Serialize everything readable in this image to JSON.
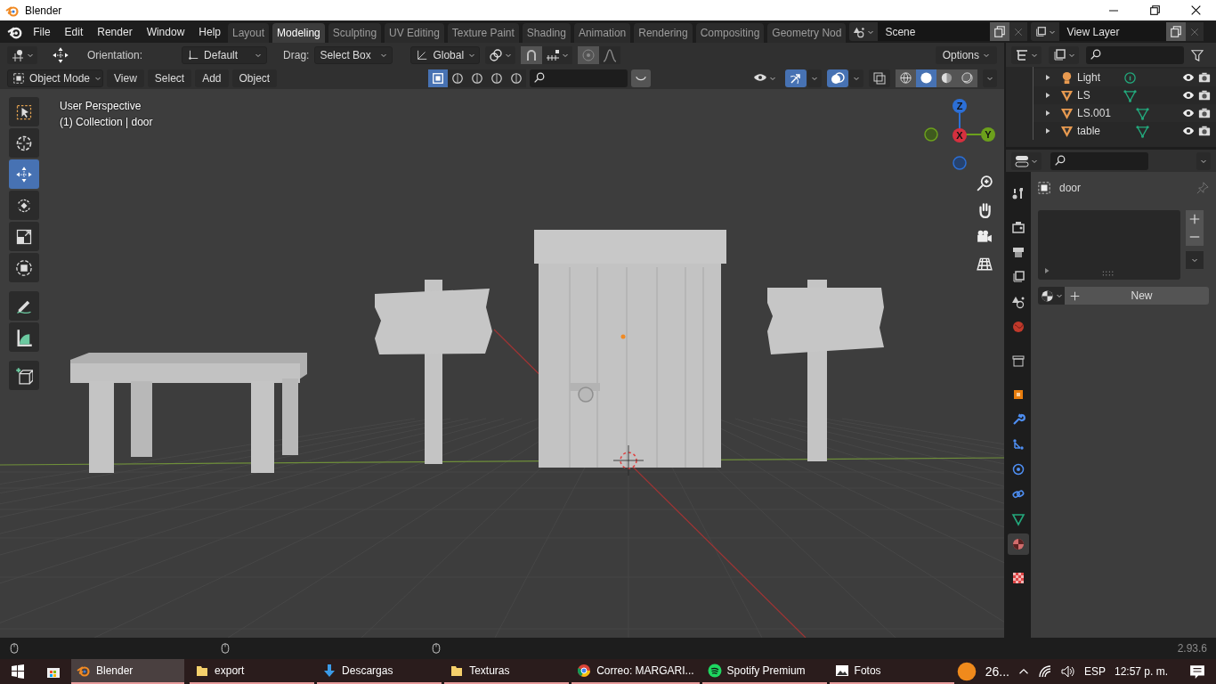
{
  "window": {
    "title": "Blender"
  },
  "menu": [
    "File",
    "Edit",
    "Render",
    "Window",
    "Help"
  ],
  "workspaces": [
    {
      "label": "Layout",
      "selected": false
    },
    {
      "label": "Modeling",
      "selected": true
    },
    {
      "label": "Sculpting",
      "selected": false
    },
    {
      "label": "UV Editing",
      "selected": false
    },
    {
      "label": "Texture Paint",
      "selected": false
    },
    {
      "label": "Shading",
      "selected": false
    },
    {
      "label": "Animation",
      "selected": false
    },
    {
      "label": "Rendering",
      "selected": false
    },
    {
      "label": "Compositing",
      "selected": false
    },
    {
      "label": "Geometry Nod",
      "selected": false
    }
  ],
  "scene": {
    "value": "Scene"
  },
  "view_layer": {
    "value": "View Layer"
  },
  "tool_header": {
    "orientation_label": "Orientation:",
    "orientation": "Default",
    "drag_label": "Drag:",
    "drag": "Select Box",
    "transform_orientation": "Global",
    "options": "Options"
  },
  "viewport_header": {
    "mode": "Object Mode",
    "menus": [
      "View",
      "Select",
      "Add",
      "Object"
    ],
    "toggles": [
      {
        "kind": "gizmo",
        "on": true
      },
      {
        "kind": "overlay",
        "on": true
      },
      {
        "kind": "xray",
        "on": false
      }
    ],
    "shading": [
      {
        "kind": "wireframe",
        "selected": false
      },
      {
        "kind": "solid",
        "selected": true
      },
      {
        "kind": "material",
        "selected": false
      },
      {
        "kind": "rendered",
        "selected": false
      }
    ]
  },
  "viewport": {
    "perspective": "User Perspective",
    "collection": "(1) Collection | door",
    "gizmo": [
      {
        "kind": "z",
        "label": "Z"
      },
      {
        "kind": "x",
        "label": "X"
      },
      {
        "kind": "y",
        "label": "Y"
      }
    ]
  },
  "tools": [
    {
      "kind": "select",
      "selected": false
    },
    {
      "kind": "cursor",
      "selected": false
    },
    {
      "kind": "move",
      "selected": true
    },
    {
      "kind": "rotate",
      "selected": false
    },
    {
      "kind": "scale",
      "selected": false
    },
    {
      "kind": "transform",
      "selected": false
    },
    {
      "kind": "annotate",
      "selected": false
    },
    {
      "kind": "measure",
      "selected": false
    },
    {
      "kind": "add_cube",
      "selected": false
    }
  ],
  "outliner": {
    "items": [
      {
        "name": "Light",
        "kind": "light"
      },
      {
        "name": "LS",
        "kind": "mesh"
      },
      {
        "name": "LS.001",
        "kind": "mesh"
      },
      {
        "name": "table",
        "kind": "mesh"
      }
    ]
  },
  "properties": {
    "tabs": [
      {
        "kind": "tool",
        "selected": false
      },
      {
        "kind": "render",
        "selected": false
      },
      {
        "kind": "output",
        "selected": false
      },
      {
        "kind": "view_layer",
        "selected": false
      },
      {
        "kind": "scene",
        "selected": false
      },
      {
        "kind": "world",
        "selected": false
      },
      {
        "kind": "collection",
        "selected": false
      },
      {
        "kind": "object",
        "selected": false
      },
      {
        "kind": "modifiers",
        "selected": false
      },
      {
        "kind": "particles",
        "selected": false
      },
      {
        "kind": "physics",
        "selected": false
      },
      {
        "kind": "constraints",
        "selected": false
      },
      {
        "kind": "data",
        "selected": false
      },
      {
        "kind": "material",
        "selected": true
      },
      {
        "kind": "texture",
        "selected": false
      }
    ],
    "object": "door",
    "new_button": "New"
  },
  "status_bar": {
    "version": "2.93.6"
  },
  "taskbar": {
    "apps": [
      {
        "label": "Blender",
        "kind": "blender",
        "selected": true
      },
      {
        "label": "export",
        "kind": "folder",
        "selected": false
      },
      {
        "label": "Descargas",
        "kind": "download",
        "selected": false
      },
      {
        "label": "Texturas",
        "kind": "folder",
        "selected": false
      },
      {
        "label": "Correo: MARGARI...",
        "kind": "chrome",
        "selected": false
      },
      {
        "label": "Spotify Premium",
        "kind": "spotify",
        "selected": false
      },
      {
        "label": "Fotos",
        "kind": "photos",
        "selected": false
      }
    ],
    "weather": "26...",
    "language": "ESP",
    "time": "12:57 p. m."
  }
}
